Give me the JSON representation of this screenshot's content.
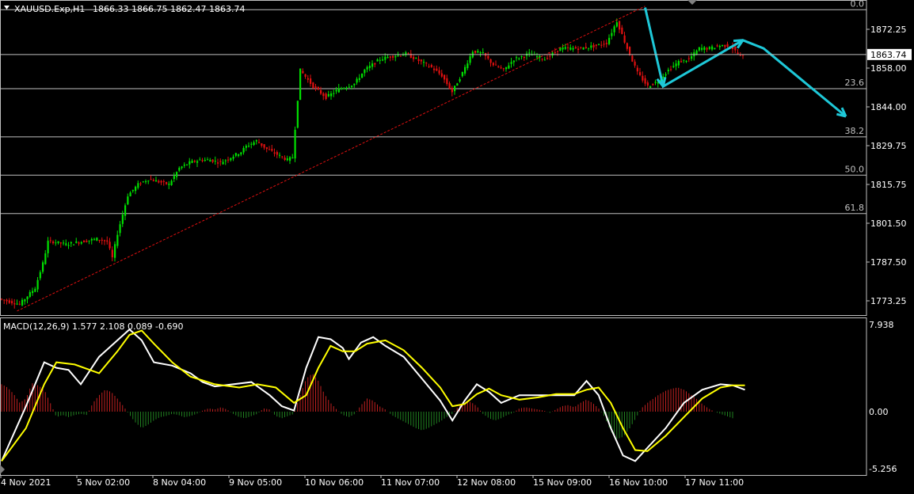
{
  "header": {
    "symbol": "XAUUSD.Exp,H1",
    "ohlc": "1866.33 1866.75 1862.47 1863.74"
  },
  "price_axis": {
    "ticks": [
      "1872.25",
      "1858.00",
      "1844.00",
      "1829.75",
      "1815.75",
      "1801.50",
      "1787.50",
      "1773.25"
    ],
    "current_price": "1863.74"
  },
  "fib_labels": [
    "0.0",
    "23.6",
    "38.2",
    "50.0",
    "61.8"
  ],
  "macd_panel": {
    "label": "MACD(12,26,9) 1.577 2.108 0.089 -0.690",
    "axis_ticks": [
      "7.938",
      "0.00",
      "-5.256"
    ]
  },
  "time_axis": {
    "labels": [
      "4 Nov 2021",
      "5 Nov 02:00",
      "8 Nov 04:00",
      "9 Nov 05:00",
      "10 Nov 06:00",
      "11 Nov 07:00",
      "12 Nov 08:00",
      "15 Nov 09:00",
      "16 Nov 10:00",
      "17 Nov 11:00"
    ]
  },
  "colors": {
    "bull": "#00e000",
    "bear": "#e01010",
    "grid": "#c0c0c0",
    "macd_line": "#ffffff",
    "signal_line": "#ffff00",
    "arrow": "#1ec8d8",
    "trendline": "#e01010",
    "hist_pos": "#c02020",
    "hist_neg": "#208020"
  },
  "chart_data": [
    {
      "type": "candlestick",
      "symbol": "XAUUSD.Exp",
      "timeframe": "H1",
      "ylim": [
        1766,
        1886
      ],
      "fib_levels": [
        {
          "label": "0.0",
          "price": 1880.2
        },
        {
          "label": "23.6",
          "price": 1851.2
        },
        {
          "label": "38.2",
          "price": 1833.5
        },
        {
          "label": "50.0",
          "price": 1819.4
        },
        {
          "label": "61.8",
          "price": 1805.3
        }
      ],
      "trendline": {
        "from": 1769.5,
        "to": 1881.5
      },
      "path_points": [
        [
          0,
          1774
        ],
        [
          8,
          1772
        ],
        [
          14,
          1778
        ],
        [
          17,
          1787
        ],
        [
          19,
          1795
        ],
        [
          21,
          1795
        ],
        [
          26,
          1794
        ],
        [
          32,
          1795
        ],
        [
          38,
          1796
        ],
        [
          42,
          1795
        ],
        [
          44,
          1789
        ],
        [
          46,
          1798
        ],
        [
          50,
          1812
        ],
        [
          54,
          1816
        ],
        [
          58,
          1818
        ],
        [
          62,
          1817
        ],
        [
          66,
          1816
        ],
        [
          70,
          1822
        ],
        [
          74,
          1824
        ],
        [
          78,
          1825
        ],
        [
          82,
          1825
        ],
        [
          86,
          1824
        ],
        [
          90,
          1826
        ],
        [
          94,
          1828
        ],
        [
          96,
          1830
        ],
        [
          100,
          1832
        ],
        [
          104,
          1829
        ],
        [
          108,
          1827
        ],
        [
          112,
          1825
        ],
        [
          114,
          1826
        ],
        [
          117,
          1858
        ],
        [
          122,
          1852
        ],
        [
          127,
          1848
        ],
        [
          132,
          1851
        ],
        [
          138,
          1853
        ],
        [
          142,
          1858
        ],
        [
          148,
          1862
        ],
        [
          152,
          1863
        ],
        [
          158,
          1864
        ],
        [
          162,
          1862
        ],
        [
          168,
          1859
        ],
        [
          172,
          1856
        ],
        [
          176,
          1850
        ],
        [
          180,
          1857
        ],
        [
          184,
          1865
        ],
        [
          188,
          1864
        ],
        [
          192,
          1860
        ],
        [
          196,
          1858
        ],
        [
          200,
          1862
        ],
        [
          206,
          1864
        ],
        [
          212,
          1862
        ],
        [
          218,
          1866
        ],
        [
          226,
          1866
        ],
        [
          232,
          1867
        ],
        [
          236,
          1868
        ],
        [
          240,
          1876
        ],
        [
          244,
          1866
        ],
        [
          248,
          1857
        ],
        [
          252,
          1852
        ],
        [
          256,
          1854
        ],
        [
          260,
          1858
        ],
        [
          264,
          1861
        ],
        [
          268,
          1862
        ],
        [
          272,
          1866
        ],
        [
          276,
          1866
        ],
        [
          280,
          1867
        ],
        [
          284,
          1867
        ],
        [
          288,
          1863
        ]
      ]
    },
    {
      "type": "line",
      "indicator": "MACD(12,26,9)",
      "ylim": [
        -5.256,
        7.938
      ],
      "series": [
        {
          "name": "MACD",
          "points": [
            [
              0,
              -4.5
            ],
            [
              8,
              0.5
            ],
            [
              14,
              4.5
            ],
            [
              18,
              4
            ],
            [
              22,
              3.8
            ],
            [
              26,
              2.5
            ],
            [
              32,
              5
            ],
            [
              38,
              6.5
            ],
            [
              42,
              7.5
            ],
            [
              46,
              6.5
            ],
            [
              50,
              4.5
            ],
            [
              56,
              4.2
            ],
            [
              62,
              3.5
            ],
            [
              66,
              2.7
            ],
            [
              70,
              2.3
            ],
            [
              76,
              2.5
            ],
            [
              82,
              2.7
            ],
            [
              88,
              1.5
            ],
            [
              92,
              0.5
            ],
            [
              96,
              0.1
            ],
            [
              100,
              4
            ],
            [
              104,
              6.8
            ],
            [
              108,
              6.6
            ],
            [
              112,
              5.8
            ],
            [
              114,
              4.8
            ],
            [
              118,
              6.3
            ],
            [
              122,
              6.8
            ],
            [
              126,
              6
            ],
            [
              132,
              5
            ],
            [
              138,
              3
            ],
            [
              144,
              1
            ],
            [
              148,
              -0.8
            ],
            [
              152,
              1
            ],
            [
              156,
              2.5
            ],
            [
              160,
              1.8
            ],
            [
              164,
              0.8
            ],
            [
              170,
              1.5
            ],
            [
              176,
              1.5
            ],
            [
              182,
              1.5
            ],
            [
              188,
              1.5
            ],
            [
              192,
              2.8
            ],
            [
              196,
              1.5
            ],
            [
              200,
              -1.5
            ],
            [
              204,
              -4
            ],
            [
              208,
              -4.5
            ],
            [
              212,
              -3.3
            ],
            [
              218,
              -1.5
            ],
            [
              224,
              0.8
            ],
            [
              230,
              2
            ],
            [
              236,
              2.5
            ],
            [
              240,
              2.4
            ],
            [
              244,
              2
            ]
          ]
        },
        {
          "name": "Signal",
          "points": [
            [
              0,
              -4.5
            ],
            [
              8,
              -1.5
            ],
            [
              14,
              2.5
            ],
            [
              18,
              4.5
            ],
            [
              24,
              4.3
            ],
            [
              32,
              3.5
            ],
            [
              38,
              5.5
            ],
            [
              42,
              7
            ],
            [
              46,
              7.4
            ],
            [
              50,
              6.2
            ],
            [
              56,
              4.5
            ],
            [
              62,
              3.2
            ],
            [
              70,
              2.5
            ],
            [
              78,
              2.2
            ],
            [
              84,
              2.5
            ],
            [
              90,
              2.2
            ],
            [
              96,
              0.8
            ],
            [
              100,
              1.5
            ],
            [
              104,
              4
            ],
            [
              108,
              6
            ],
            [
              112,
              5.5
            ],
            [
              116,
              5.5
            ],
            [
              120,
              6.2
            ],
            [
              126,
              6.5
            ],
            [
              132,
              5.6
            ],
            [
              138,
              4
            ],
            [
              144,
              2.2
            ],
            [
              148,
              0.5
            ],
            [
              152,
              0.7
            ],
            [
              156,
              1.6
            ],
            [
              160,
              2.1
            ],
            [
              164,
              1.5
            ],
            [
              170,
              1.1
            ],
            [
              176,
              1.3
            ],
            [
              182,
              1.6
            ],
            [
              188,
              1.6
            ],
            [
              192,
              2
            ],
            [
              196,
              2.2
            ],
            [
              200,
              0.8
            ],
            [
              204,
              -1.5
            ],
            [
              208,
              -3.5
            ],
            [
              212,
              -3.6
            ],
            [
              218,
              -2.2
            ],
            [
              224,
              -0.5
            ],
            [
              230,
              1.2
            ],
            [
              236,
              2.2
            ],
            [
              240,
              2.4
            ],
            [
              244,
              2.4
            ]
          ]
        }
      ],
      "histogram": [
        [
          0,
          2.5
        ],
        [
          2,
          2.2
        ],
        [
          4,
          1.6
        ],
        [
          6,
          0.8
        ],
        [
          8,
          1.2
        ],
        [
          10,
          2.6
        ],
        [
          12,
          2.4
        ],
        [
          14,
          2
        ],
        [
          16,
          0.8
        ],
        [
          18,
          -0.5
        ],
        [
          20,
          -0.3
        ],
        [
          22,
          -0.5
        ],
        [
          24,
          -0.3
        ],
        [
          26,
          -0.2
        ],
        [
          28,
          -0.3
        ],
        [
          30,
          0.8
        ],
        [
          32,
          1.5
        ],
        [
          34,
          2
        ],
        [
          36,
          1.8
        ],
        [
          38,
          1.2
        ],
        [
          40,
          0.5
        ],
        [
          42,
          -0.3
        ],
        [
          44,
          -1
        ],
        [
          46,
          -1.5
        ],
        [
          48,
          -1.2
        ],
        [
          50,
          -0.8
        ],
        [
          52,
          -0.5
        ],
        [
          54,
          -0.4
        ],
        [
          56,
          -0.2
        ],
        [
          58,
          -0.3
        ],
        [
          60,
          -0.5
        ],
        [
          62,
          -0.4
        ],
        [
          64,
          -0.2
        ],
        [
          66,
          0.1
        ],
        [
          68,
          0.3
        ],
        [
          70,
          0.2
        ],
        [
          72,
          0.4
        ],
        [
          74,
          0.2
        ],
        [
          76,
          -0.2
        ],
        [
          78,
          -0.5
        ],
        [
          80,
          -0.6
        ],
        [
          82,
          -0.4
        ],
        [
          84,
          -0.2
        ],
        [
          86,
          0.3
        ],
        [
          88,
          0.2
        ],
        [
          90,
          -0.4
        ],
        [
          92,
          -0.6
        ],
        [
          94,
          -0.4
        ],
        [
          96,
          -0.2
        ],
        [
          98,
          1.5
        ],
        [
          100,
          3
        ],
        [
          102,
          3.5
        ],
        [
          104,
          2.8
        ],
        [
          106,
          1.6
        ],
        [
          108,
          0.8
        ],
        [
          110,
          0.2
        ],
        [
          112,
          -0.3
        ],
        [
          114,
          -0.5
        ],
        [
          116,
          -0.2
        ],
        [
          118,
          0.6
        ],
        [
          120,
          1.2
        ],
        [
          122,
          1
        ],
        [
          124,
          0.5
        ],
        [
          126,
          0.2
        ],
        [
          128,
          -0.3
        ],
        [
          130,
          -0.6
        ],
        [
          132,
          -0.9
        ],
        [
          134,
          -1.2
        ],
        [
          136,
          -1.5
        ],
        [
          138,
          -1.7
        ],
        [
          140,
          -1.5
        ],
        [
          142,
          -1.2
        ],
        [
          144,
          -0.9
        ],
        [
          146,
          -0.5
        ],
        [
          148,
          -0.2
        ],
        [
          150,
          0.5
        ],
        [
          152,
          0.8
        ],
        [
          154,
          0.9
        ],
        [
          156,
          0.5
        ],
        [
          158,
          -0.2
        ],
        [
          160,
          -0.6
        ],
        [
          162,
          -0.8
        ],
        [
          164,
          -0.6
        ],
        [
          166,
          -0.3
        ],
        [
          168,
          -0.1
        ],
        [
          170,
          0.3
        ],
        [
          172,
          0.4
        ],
        [
          174,
          0.3
        ],
        [
          176,
          0.2
        ],
        [
          178,
          0.1
        ],
        [
          180,
          -0.1
        ],
        [
          182,
          0.2
        ],
        [
          184,
          0.5
        ],
        [
          186,
          0.6
        ],
        [
          188,
          0.4
        ],
        [
          190,
          0.8
        ],
        [
          192,
          1.1
        ],
        [
          194,
          0.8
        ],
        [
          196,
          0.3
        ],
        [
          198,
          -0.5
        ],
        [
          200,
          -1.8
        ],
        [
          202,
          -2.5
        ],
        [
          204,
          -2.3
        ],
        [
          206,
          -1.6
        ],
        [
          208,
          -0.7
        ],
        [
          210,
          0.3
        ],
        [
          212,
          0.8
        ],
        [
          214,
          1.2
        ],
        [
          216,
          1.6
        ],
        [
          218,
          1.9
        ],
        [
          220,
          2.1
        ],
        [
          222,
          2.2
        ],
        [
          224,
          2
        ],
        [
          226,
          1.6
        ],
        [
          228,
          1.2
        ],
        [
          230,
          0.7
        ],
        [
          232,
          0.3
        ],
        [
          234,
          0
        ],
        [
          236,
          -0.2
        ],
        [
          238,
          -0.4
        ],
        [
          240,
          -0.6
        ]
      ]
    }
  ]
}
